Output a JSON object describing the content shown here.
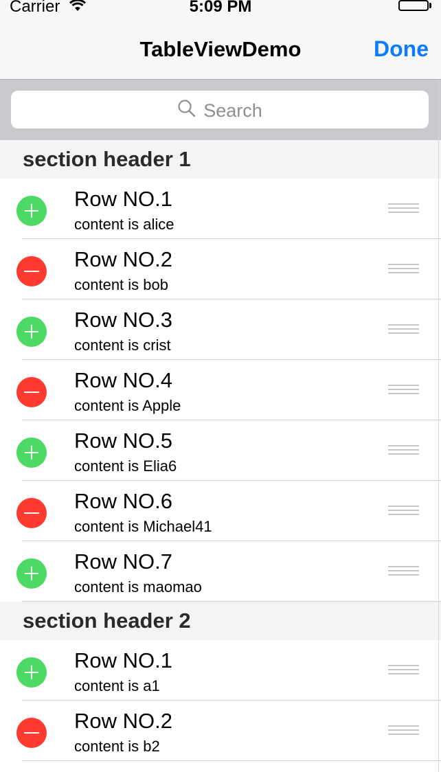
{
  "status_bar": {
    "carrier": "Carrier",
    "time": "5:09 PM"
  },
  "nav": {
    "title": "TableViewDemo",
    "done_label": "Done"
  },
  "search": {
    "placeholder": "Search"
  },
  "sections": [
    {
      "header": "section header 1",
      "rows": [
        {
          "title": "Row NO.1",
          "subtitle": "content is alice",
          "control": "insert"
        },
        {
          "title": "Row NO.2",
          "subtitle": "content is bob",
          "control": "delete"
        },
        {
          "title": "Row NO.3",
          "subtitle": "content is crist",
          "control": "insert"
        },
        {
          "title": "Row NO.4",
          "subtitle": "content is Apple",
          "control": "delete"
        },
        {
          "title": "Row NO.5",
          "subtitle": "content is Elia6",
          "control": "insert"
        },
        {
          "title": "Row NO.6",
          "subtitle": "content is Michael41",
          "control": "delete"
        },
        {
          "title": "Row NO.7",
          "subtitle": "content is maomao",
          "control": "insert"
        }
      ]
    },
    {
      "header": "section header 2",
      "rows": [
        {
          "title": "Row NO.1",
          "subtitle": "content is a1",
          "control": "insert"
        },
        {
          "title": "Row NO.2",
          "subtitle": "content is b2",
          "control": "delete"
        }
      ]
    }
  ],
  "colors": {
    "accent": "#0a7cff",
    "insert": "#4cd964",
    "delete": "#ff3b30"
  }
}
